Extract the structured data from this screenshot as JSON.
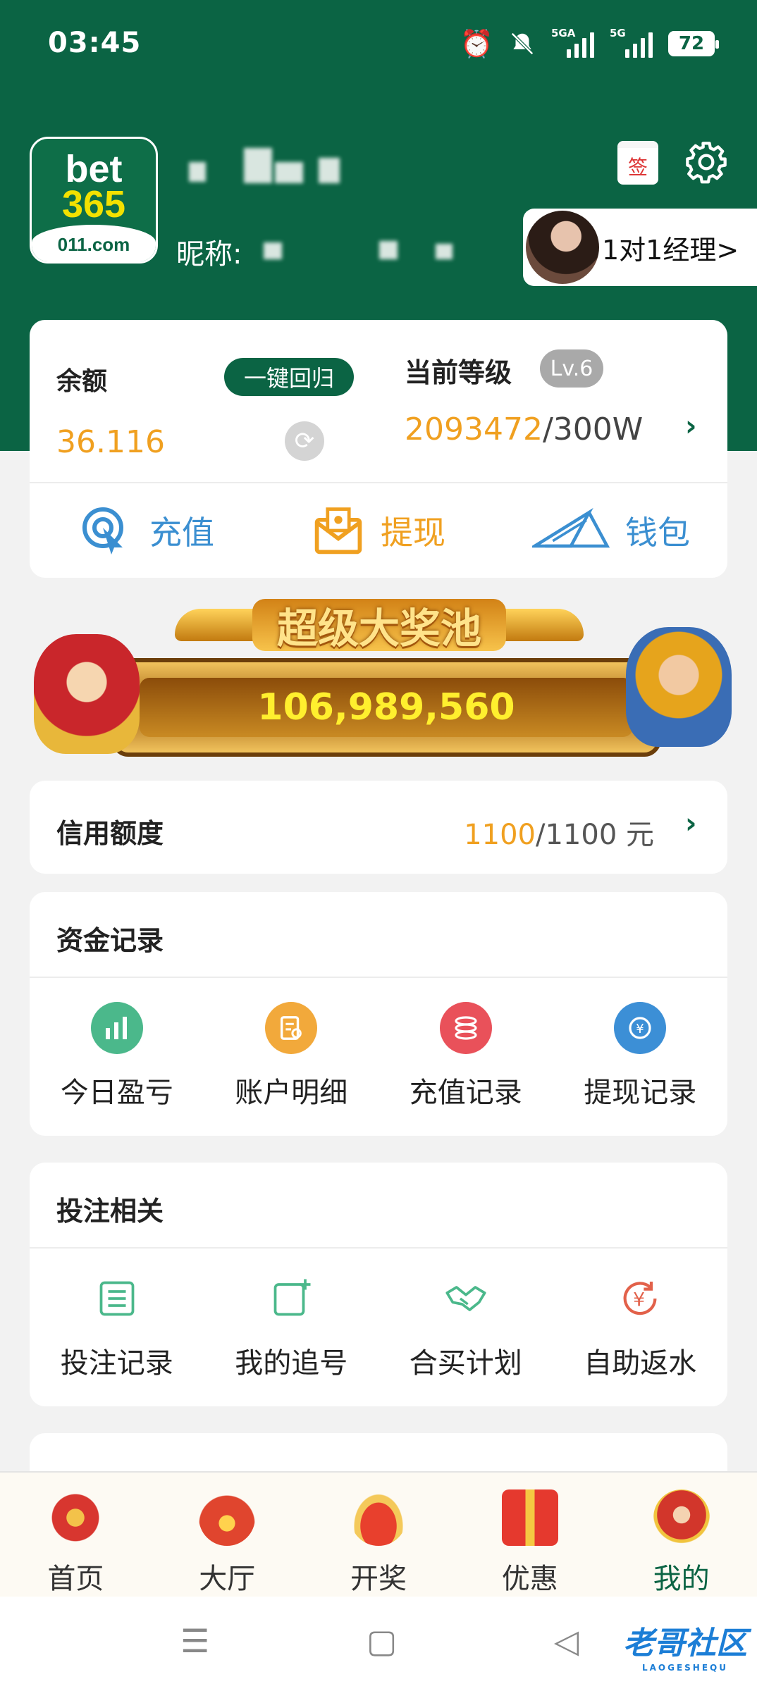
{
  "status_bar": {
    "time": "03:45",
    "signal1": "5GA",
    "signal2": "5G",
    "battery": "72"
  },
  "profile": {
    "logo": {
      "line1": "bet",
      "line2": "365",
      "line3": "011.com"
    },
    "nickname_label": "昵称:",
    "sign_label": "签",
    "manager_label": "1对1经理>"
  },
  "balance": {
    "label": "余额",
    "value": "36.116",
    "recall_button": "一键回归",
    "level_label": "当前等级",
    "level_badge": "Lv.6",
    "level_current": "2093472",
    "level_target": "/300W"
  },
  "actions": [
    {
      "label": "充值",
      "icon": "recharge-icon",
      "color": "#3b8fd1"
    },
    {
      "label": "提现",
      "icon": "withdraw-icon",
      "color": "#f0a020"
    },
    {
      "label": "钱包",
      "icon": "wallet-icon",
      "color": "#3b8fd1"
    }
  ],
  "jackpot": {
    "title": "超级大奖池",
    "amount": "106,989,560"
  },
  "credit": {
    "label": "信用额度",
    "used": "1100",
    "total": "/1100 元"
  },
  "funds": {
    "title": "资金记录",
    "items": [
      {
        "label": "今日盈亏",
        "icon": "chart-icon",
        "color": "#4bb88b"
      },
      {
        "label": "账户明细",
        "icon": "receipt-icon",
        "color": "#f2a93b"
      },
      {
        "label": "充值记录",
        "icon": "coins-icon",
        "color": "#e9515a"
      },
      {
        "label": "提现记录",
        "icon": "yuan-icon",
        "color": "#3c8fd6"
      }
    ]
  },
  "betting": {
    "title": "投注相关",
    "items": [
      {
        "label": "投注记录",
        "icon": "list-icon",
        "color": "#4bb88b"
      },
      {
        "label": "我的追号",
        "icon": "add-square-icon",
        "color": "#4bb88b"
      },
      {
        "label": "合买计划",
        "icon": "handshake-icon",
        "color": "#4bb88b"
      },
      {
        "label": "自助返水",
        "icon": "yuan-refresh-icon",
        "color": "#e2614a"
      }
    ]
  },
  "bottom_nav": [
    {
      "label": "首页",
      "icon": "home-icon"
    },
    {
      "label": "大厅",
      "icon": "lobby-icon"
    },
    {
      "label": "开奖",
      "icon": "lottery-icon"
    },
    {
      "label": "优惠",
      "icon": "gift-icon"
    },
    {
      "label": "我的",
      "icon": "profile-icon",
      "active": true
    }
  ],
  "watermark": {
    "text": "老哥社区",
    "sub": "LAOGESHEQU"
  }
}
